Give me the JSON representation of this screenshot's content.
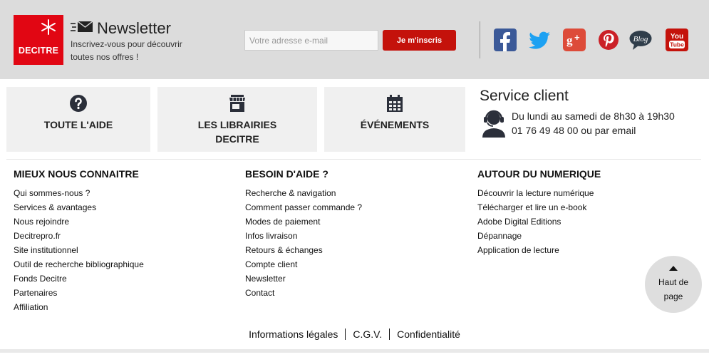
{
  "brand": {
    "logo_text": "DECITRE",
    "color": "#e10613"
  },
  "newsletter": {
    "icon": "envelope-icon",
    "title": "Newsletter",
    "description": "Inscrivez-vous pour découvrir toutes nos offres !",
    "email_placeholder": "Votre adresse e-mail",
    "email_value": "",
    "subscribe_label": "Je m'inscris",
    "button_color": "#c4120b"
  },
  "social": [
    {
      "name": "facebook-icon",
      "color": "#3b5998"
    },
    {
      "name": "twitter-icon",
      "color": "#1da1f2"
    },
    {
      "name": "google-plus-icon",
      "color": "#dd4b39"
    },
    {
      "name": "pinterest-icon",
      "color": "#cb2027"
    },
    {
      "name": "blog-icon",
      "label": "Blog",
      "color": "#2f3d4a"
    },
    {
      "name": "youtube-icon",
      "label_top": "You",
      "label_bottom": "Tube",
      "color": "#c4120b"
    }
  ],
  "help_tiles": [
    {
      "icon": "question-circle-icon",
      "label": "TOUTE L'AIDE"
    },
    {
      "icon": "store-icon",
      "label_line1": "LES LIBRAIRIES",
      "label_line2": "DECITRE"
    },
    {
      "icon": "calendar-icon",
      "label": "ÉVÉNEMENTS"
    }
  ],
  "service_client": {
    "title": "Service client",
    "icon": "headset-agent-icon",
    "hours": "Du lundi au samedi de 8h30 à 19h30",
    "contact": "01 76 49 48 00 ou par email"
  },
  "columns": [
    {
      "title": "MIEUX NOUS CONNAITRE",
      "links": [
        "Qui sommes-nous ?",
        "Services & avantages",
        "Nous rejoindre",
        "Decitrepro.fr",
        "Site institutionnel",
        "Outil de recherche bibliographique",
        "Fonds Decitre",
        "Partenaires",
        "Affiliation"
      ]
    },
    {
      "title": "BESOIN D'AIDE ?",
      "links": [
        "Recherche & navigation",
        "Comment passer commande ?",
        "Modes de paiement",
        "Infos livraison",
        "Retours & échanges",
        "Compte client",
        "Newsletter",
        "Contact"
      ]
    },
    {
      "title": "AUTOUR DU NUMERIQUE",
      "links": [
        "Découvrir la lecture numérique",
        "Télécharger et lire un e-book",
        "Adobe Digital Editions",
        "Dépannage",
        "Application de lecture"
      ]
    }
  ],
  "back_to_top": {
    "label": "Haut de page"
  },
  "legal": [
    "Informations légales",
    "C.G.V.",
    "Confidentialité"
  ]
}
